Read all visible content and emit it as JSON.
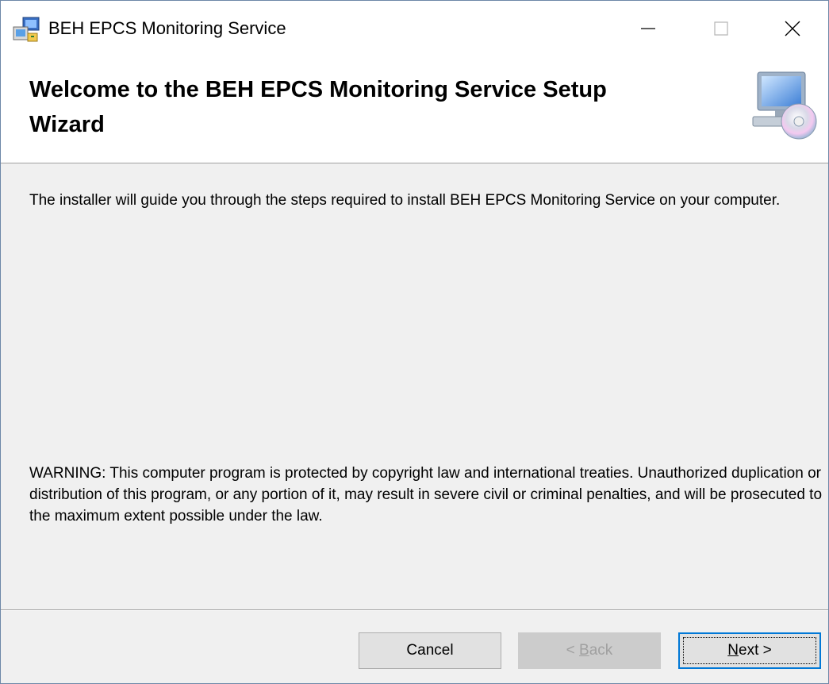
{
  "window": {
    "title": "BEH EPCS Monitoring Service"
  },
  "header": {
    "title": "Welcome to the BEH EPCS Monitoring Service Setup Wizard",
    "image_icon": "computer-cd-icon"
  },
  "body": {
    "intro": "The installer will guide you through the steps required to install BEH EPCS Monitoring Service on your computer.",
    "warning": "WARNING: This computer program is protected by copyright law and international treaties. Unauthorized duplication or distribution of this program, or any portion of it, may result in severe civil or criminal penalties, and will be prosecuted to the maximum extent possible under the law."
  },
  "buttons": {
    "cancel": "Cancel",
    "back_prefix": "< ",
    "back_mnemonic": "B",
    "back_rest": "ack",
    "next_mnemonic": "N",
    "next_rest": "ext >"
  },
  "colors": {
    "accent": "#0078d7",
    "face": "#f0f0f0"
  }
}
